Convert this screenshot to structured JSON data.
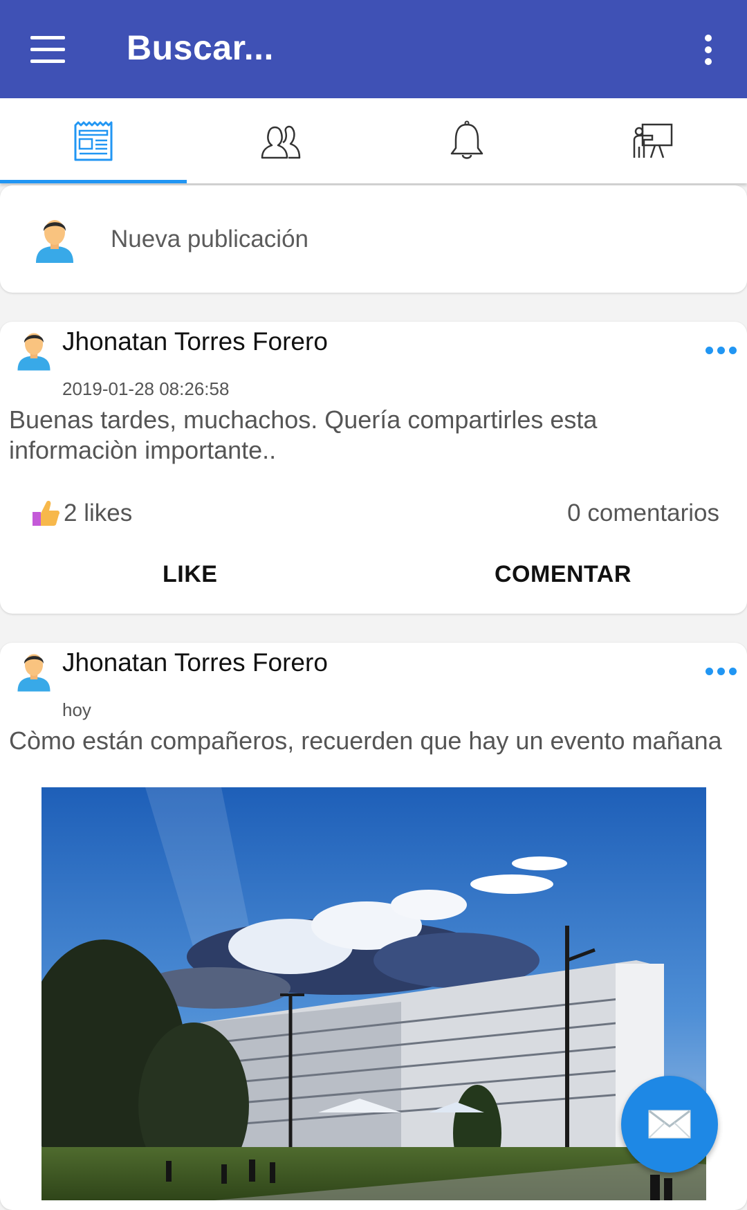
{
  "appbar": {
    "title": "Buscar...",
    "menu_icon": "menu-icon",
    "overflow_icon": "more-vert-icon",
    "background": "#3f51b5"
  },
  "tabs": [
    {
      "icon": "newspaper-icon",
      "selected": true
    },
    {
      "icon": "people-icon",
      "selected": false
    },
    {
      "icon": "bell-icon",
      "selected": false
    },
    {
      "icon": "presentation-icon",
      "selected": false
    }
  ],
  "new_post": {
    "placeholder": "Nueva publicación"
  },
  "posts": [
    {
      "author": "Jhonatan Torres Forero",
      "timestamp": "2019-01-28 08:26:58",
      "text": "Buenas tardes, muchachos. Quería compartirles esta informaciòn importante..",
      "likes": "2 likes",
      "comments": "0 comentarios",
      "like_label": "LIKE",
      "comment_label": "COMENTAR"
    },
    {
      "author": "Jhonatan Torres Forero",
      "timestamp": "hoy",
      "text": "Còmo están compañeros, recuerden que hay un evento mañana",
      "has_image": true
    }
  ],
  "fab": {
    "icon": "mail-icon"
  },
  "colors": {
    "accent": "#2196f3",
    "fab": "#1e88e5"
  }
}
